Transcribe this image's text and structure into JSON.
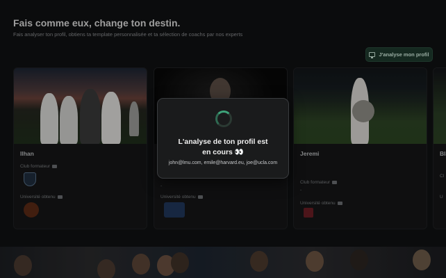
{
  "header": {
    "title": "Fais comme eux, change ton destin.",
    "subtitle": "Fais analyser ton profil, obtiens ta template personnalisée et ta sélection de coachs par nos experts"
  },
  "cta": {
    "label": "J'analyse mon profil",
    "icon": "screen-icon"
  },
  "cards": [
    {
      "name": "Ilhan",
      "club_label": "Club formateur",
      "university_label": "Université obtenu",
      "university_value": ""
    },
    {
      "name": "",
      "club_label": "",
      "university_label": "Université obtenu",
      "dash": "-"
    },
    {
      "name": "Jeremi",
      "club_label": "Club formateur",
      "club_value": "-",
      "university_label": "Université obtenu"
    },
    {
      "name": "Bla",
      "club_label": "Cl",
      "university_label": "U"
    }
  ],
  "modal": {
    "title": "L'analyse de ton profil est en cours 👀",
    "subtitle": "john@lmu.com, emile@harvard.eu, joe@ucla.com"
  },
  "colors": {
    "accent": "#3ea37a",
    "cta_bg": "#1e3a2d"
  }
}
